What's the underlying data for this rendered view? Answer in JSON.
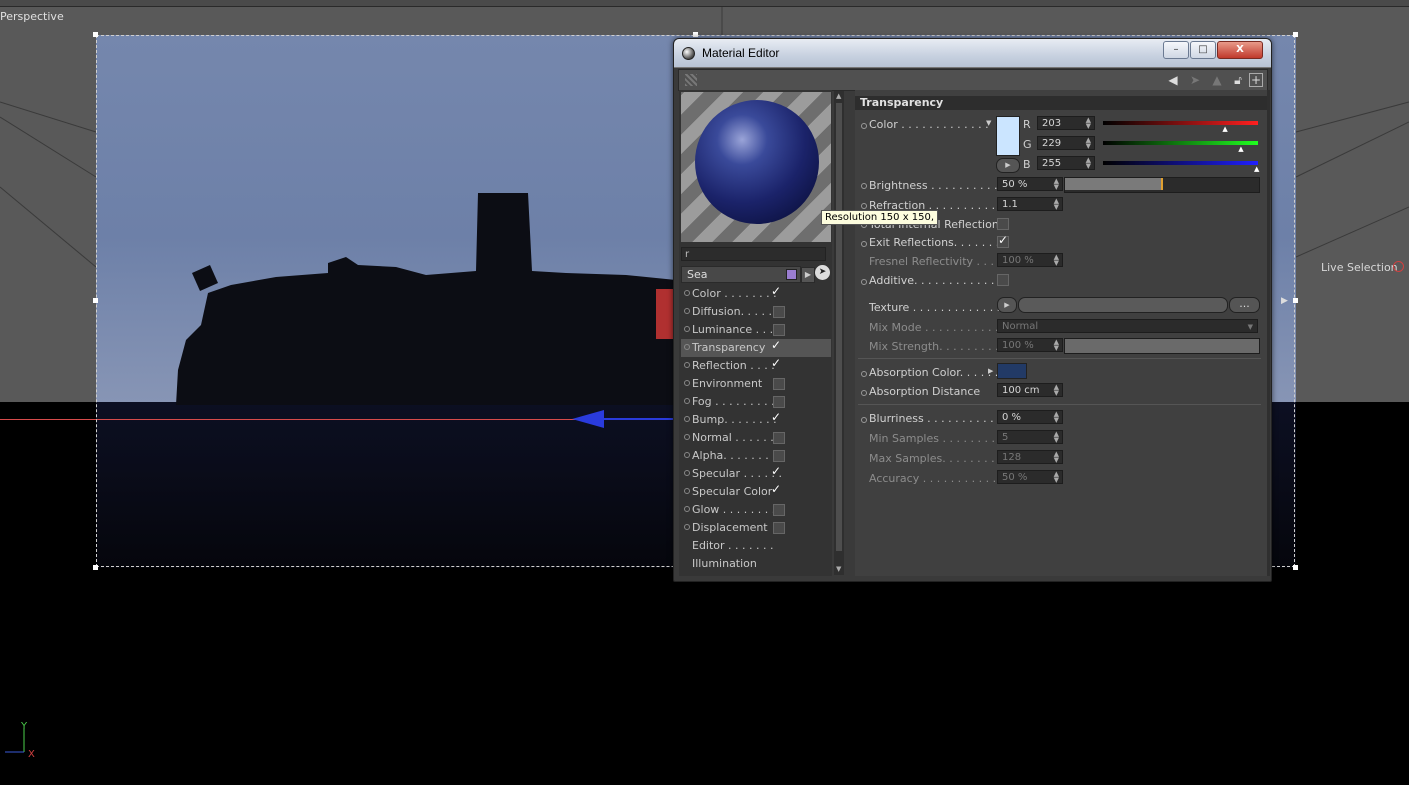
{
  "viewport": {
    "label": "Perspective",
    "live_selection": "Live Selection",
    "axis_y": "Y",
    "axis_x": "X"
  },
  "editor": {
    "title": "Material Editor",
    "window_buttons": {
      "minimize": "–",
      "maximize": "□",
      "close": "X"
    },
    "tooltip": "Resolution 150 x 150,",
    "name_field": "r",
    "material_name": "Sea",
    "channels": [
      {
        "label": "Color . . . . . . . .",
        "checked": true,
        "has_box": true
      },
      {
        "label": "Diffusion. . . . . .",
        "checked": false,
        "has_box": true
      },
      {
        "label": "Luminance . . . .",
        "checked": false,
        "has_box": true
      },
      {
        "label": "Transparency",
        "checked": true,
        "has_box": true,
        "selected": true
      },
      {
        "label": "Reflection . . . .",
        "checked": true,
        "has_box": true
      },
      {
        "label": "Environment",
        "checked": false,
        "has_box": true
      },
      {
        "label": "Fog . . . . . . . . .",
        "checked": false,
        "has_box": true
      },
      {
        "label": "Bump. . . . . . . .",
        "checked": true,
        "has_box": true
      },
      {
        "label": "Normal . . . . . . .",
        "checked": false,
        "has_box": true
      },
      {
        "label": "Alpha. . . . . . . .",
        "checked": false,
        "has_box": true
      },
      {
        "label": "Specular . . . . . .",
        "checked": true,
        "has_box": true
      },
      {
        "label": "Specular Color",
        "checked": true,
        "has_box": true
      },
      {
        "label": "Glow . . . . . . . .",
        "checked": false,
        "has_box": true
      },
      {
        "label": "Displacement",
        "checked": false,
        "has_box": true
      },
      {
        "label": "Editor . . . . . . .",
        "checked": false,
        "has_box": false
      },
      {
        "label": "Illumination",
        "checked": false,
        "has_box": false
      }
    ],
    "section": "Transparency",
    "color": {
      "label": "Color . . . . . . . . . . . . .",
      "swatch": "#cbe5ff",
      "r_label": "R",
      "r": "203",
      "g_label": "G",
      "g": "229",
      "b_label": "B",
      "b": "255",
      "r_fraction": 0.796,
      "g_fraction": 0.898,
      "b_fraction": 1.0
    },
    "brightness": {
      "label": "Brightness . . . . . . . . . . .",
      "value": "50 %",
      "fraction": 0.5
    },
    "refraction": {
      "label": "Refraction . . . . . . . . . . .",
      "value": "1.1"
    },
    "total_reflection": {
      "label": "Total Internal Reflection",
      "checked": false
    },
    "exit_reflections": {
      "label": "Exit Reflections. . . . . . . .",
      "checked": true
    },
    "fresnel": {
      "label": "Fresnel Reflectivity . . . . .",
      "value": "100 %"
    },
    "additive": {
      "label": "Additive. . . . . . . . . . . . .",
      "checked": false
    },
    "texture": {
      "label": "Texture . . . . . . . . . . . . .",
      "more": "..."
    },
    "mix_mode": {
      "label": "Mix Mode . . . . . . . . . . . .",
      "value": "Normal"
    },
    "mix_strength": {
      "label": "Mix Strength. . . . . . . . . .",
      "value": "100 %"
    },
    "absorption_color": {
      "label": "Absorption Color. . . . . . .",
      "swatch": "#223a66"
    },
    "absorption_distance": {
      "label": "Absorption Distance",
      "value": "100 cm"
    },
    "blurriness": {
      "label": "Blurriness . . . . . . . . . . . .",
      "value": "0 %"
    },
    "min_samples": {
      "label": "Min Samples . . . . . . . . . .",
      "value": "5"
    },
    "max_samples": {
      "label": "Max Samples. . . . . . . . . .",
      "value": "128"
    },
    "accuracy": {
      "label": "Accuracy . . . . . . . . . . . . .",
      "value": "50 %"
    }
  }
}
